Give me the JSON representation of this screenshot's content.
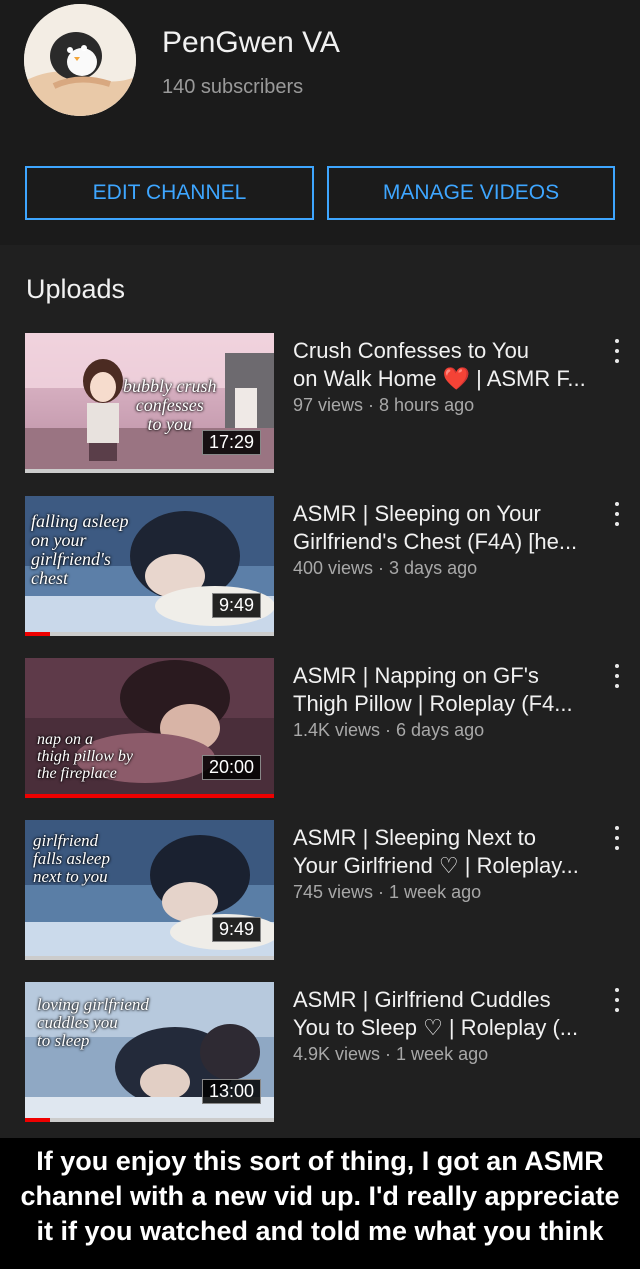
{
  "channel": {
    "name": "PenGwen VA",
    "subscribers": "140 subscribers",
    "edit_label": "EDIT CHANNEL",
    "manage_label": "MANAGE VIDEOS"
  },
  "section_title": "Uploads",
  "videos": [
    {
      "title_line1": "Crush Confesses to You",
      "title_line2_a": "on Walk Home ",
      "title_line2_heart": "❤️",
      "title_line2_b": " | ASMR F...",
      "meta": "97 views · 8 hours ago",
      "duration": "17:29",
      "thumb_text": "bubbly crush\nconfesses\nto you",
      "progress": 0.0
    },
    {
      "title_line1": "ASMR | Sleeping on Your",
      "title_line2": "Girlfriend's Chest (F4A) [he...",
      "meta": "400 views · 3 days ago",
      "duration": "9:49",
      "thumb_text": "falling asleep\non your\ngirlfriend's\nchest",
      "progress": 0.1
    },
    {
      "title_line1": "ASMR | Napping on GF's",
      "title_line2": "Thigh Pillow | Roleplay (F4...",
      "meta": "1.4K views · 6 days ago",
      "duration": "20:00",
      "thumb_text": "nap on a\nthigh pillow by\nthe fireplace",
      "progress": 1.0
    },
    {
      "title_line1": "ASMR | Sleeping Next to",
      "title_line2": "Your Girlfriend ♡ | Roleplay...",
      "meta": "745 views · 1 week ago",
      "duration": "9:49",
      "thumb_text": "girlfriend\nfalls asleep\nnext to you",
      "progress": 0.0
    },
    {
      "title_line1": "ASMR | Girlfriend Cuddles",
      "title_line2": "You to Sleep ♡ | Roleplay (...",
      "meta": "4.9K views · 1 week ago",
      "duration": "13:00",
      "thumb_text": "loving girlfriend\ncuddles you\nto sleep",
      "progress": 0.1
    }
  ],
  "caption": {
    "line1": "If you enjoy this sort of thing, I got an ASMR",
    "line2": "channel with a new vid up. I'd really appreciate",
    "line3": "it if you watched and told me what you think"
  },
  "icons": {
    "more": "kebab-vertical-icon",
    "avatar": "penguin-avatar"
  },
  "colors": {
    "accent": "#3ea6ff",
    "progress": "#e00000",
    "background": "#202020"
  }
}
